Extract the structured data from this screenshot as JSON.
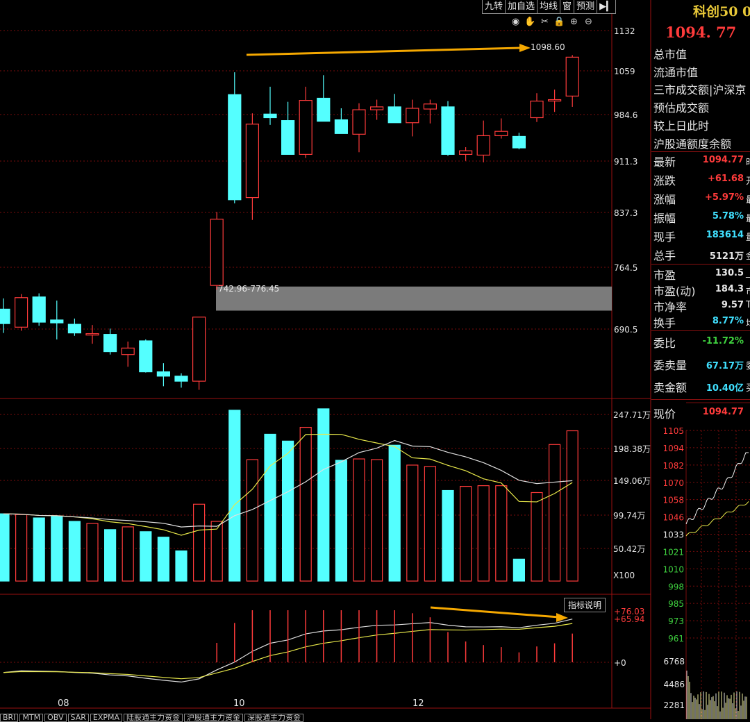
{
  "toolbar": {
    "buttons": [
      "九转",
      "加自选",
      "均线",
      "窗",
      "预测",
      "▶▎"
    ]
  },
  "tool_icons": [
    "eye-icon",
    "hand-icon",
    "scissors-icon",
    "lock-icon",
    "zoom-in-icon",
    "zoom-out-icon"
  ],
  "quote": {
    "name": "科创50 0",
    "last": "1094. 77",
    "info_labels": [
      "总市值",
      "流通市值",
      "三市成交额|沪深京",
      "预估成交额",
      "较上日此时",
      "沪股通额度余额"
    ],
    "stats": [
      {
        "label": "最新",
        "value": "1094.77",
        "suffix": "时",
        "color": "#ff3b3b"
      },
      {
        "label": "涨跌",
        "value": "+61.68",
        "suffix": "开",
        "color": "#ff3b3b"
      },
      {
        "label": "涨幅",
        "value": "+5.97%",
        "suffix": "最",
        "color": "#ff3b3b"
      },
      {
        "label": "振幅",
        "value": "5.78%",
        "suffix": "最",
        "color": "#40e0ff"
      },
      {
        "label": "现手",
        "value": "183614",
        "suffix": "量",
        "color": "#40e0ff"
      },
      {
        "label": "总手",
        "value": "5121万",
        "suffix": "金",
        "color": "#e6e6e6"
      }
    ],
    "valuation": [
      {
        "label": "市盈",
        "value": "130.5",
        "suffix": "_"
      },
      {
        "label": "市盈(动)",
        "value": "184.3",
        "suffix": "市"
      },
      {
        "label": "市净率",
        "value": "9.57",
        "suffix": "T"
      },
      {
        "label": "换手",
        "value": "8.77%",
        "suffix": "均",
        "color": "#40e0ff"
      }
    ],
    "order": [
      {
        "label": "委比",
        "value": "-11.72%",
        "suffix": "",
        "color": "#3fd23f"
      },
      {
        "label": "委卖量",
        "value": "67.17万",
        "suffix": "委",
        "color": "#40e0ff"
      },
      {
        "label": "卖金额",
        "value": "10.40亿",
        "suffix": "买",
        "color": "#40e0ff"
      }
    ],
    "intraday_label": "现价",
    "intraday_value": "1094.77",
    "intraday_ticks": [
      "1105",
      "1094",
      "1082",
      "1070",
      "1058",
      "1046",
      "1033",
      "1021",
      "1010",
      "998",
      "985",
      "973",
      "961"
    ],
    "intraday_vol_ticks": [
      "6768",
      "4486",
      "2281"
    ]
  },
  "x_labels": [
    "08",
    "10",
    "12"
  ],
  "indicator_tabs": [
    "BRI",
    "MTM",
    "OBV",
    "SAR",
    "EXPMA",
    "陆股通主力资金",
    "沪股通主力资金",
    "深股通主力资金"
  ],
  "indicator_button": "指标说明",
  "chart_data": {
    "type": "candlestick",
    "price_axis": {
      "ticks": [
        "1132",
        "1059",
        "984.6",
        "911.3",
        "837.3",
        "764.5",
        "690.5"
      ],
      "min": 620,
      "max": 1132
    },
    "annotations": {
      "peak_label": "1098.60",
      "gap_label": "742.96-776.45",
      "gap_range": [
        742.96,
        776.45
      ]
    },
    "candles": [
      {
        "o": 745,
        "h": 760,
        "l": 712,
        "c": 725
      },
      {
        "o": 720,
        "h": 766,
        "l": 715,
        "c": 761
      },
      {
        "o": 762,
        "h": 767,
        "l": 722,
        "c": 727
      },
      {
        "o": 730,
        "h": 757,
        "l": 703,
        "c": 726
      },
      {
        "o": 724,
        "h": 732,
        "l": 708,
        "c": 712
      },
      {
        "o": 711,
        "h": 723,
        "l": 697,
        "c": 711
      },
      {
        "o": 710,
        "h": 718,
        "l": 682,
        "c": 686
      },
      {
        "o": 682,
        "h": 700,
        "l": 665,
        "c": 691
      },
      {
        "o": 701,
        "h": 703,
        "l": 657,
        "c": 658
      },
      {
        "o": 658,
        "h": 670,
        "l": 638,
        "c": 652
      },
      {
        "o": 652,
        "h": 656,
        "l": 636,
        "c": 645
      },
      {
        "o": 645,
        "h": 734,
        "l": 633,
        "c": 734
      },
      {
        "o": 778,
        "h": 880,
        "l": 772,
        "c": 870
      },
      {
        "o": 1043,
        "h": 1074,
        "l": 892,
        "c": 897
      },
      {
        "o": 900,
        "h": 1017,
        "l": 869,
        "c": 1002
      },
      {
        "o": 1016,
        "h": 1054,
        "l": 1001,
        "c": 1011
      },
      {
        "o": 1007,
        "h": 1033,
        "l": 960,
        "c": 960
      },
      {
        "o": 960,
        "h": 1054,
        "l": 955,
        "c": 1035
      },
      {
        "o": 1038,
        "h": 1070,
        "l": 1008,
        "c": 1006
      },
      {
        "o": 1008,
        "h": 1024,
        "l": 994,
        "c": 989
      },
      {
        "o": 988,
        "h": 1031,
        "l": 963,
        "c": 1022
      },
      {
        "o": 1022,
        "h": 1036,
        "l": 1008,
        "c": 1026
      },
      {
        "o": 1026,
        "h": 1044,
        "l": 1004,
        "c": 1004
      },
      {
        "o": 1004,
        "h": 1036,
        "l": 985,
        "c": 1024
      },
      {
        "o": 1023,
        "h": 1036,
        "l": 1003,
        "c": 1030
      },
      {
        "o": 1026,
        "h": 1034,
        "l": 958,
        "c": 960
      },
      {
        "o": 960,
        "h": 970,
        "l": 951,
        "c": 965
      },
      {
        "o": 959,
        "h": 1007,
        "l": 949,
        "c": 986
      },
      {
        "o": 986,
        "h": 1010,
        "l": 982,
        "c": 992
      },
      {
        "o": 985,
        "h": 990,
        "l": 967,
        "c": 969
      },
      {
        "o": 1011,
        "h": 1045,
        "l": 1005,
        "c": 1034
      },
      {
        "o": 1036,
        "h": 1050,
        "l": 1019,
        "c": 1036
      },
      {
        "o": 1041,
        "h": 1098,
        "l": 1026,
        "c": 1095
      }
    ],
    "volume_axis": {
      "ticks": [
        "247.71万",
        "198.38万",
        "149.06万",
        "99.74万",
        "50.42万"
      ],
      "unit": "X100",
      "max": 260
    },
    "volume": [
      98,
      97,
      92,
      94,
      87,
      84,
      75,
      79,
      72,
      64,
      44,
      112,
      87,
      249,
      177,
      214,
      204,
      224,
      251,
      176,
      178,
      177,
      198,
      169,
      167,
      132,
      138,
      139,
      139,
      32,
      129,
      199,
      219
    ],
    "indicator_axis": {
      "ticks": [
        "+76.03",
        "+65.94",
        "+0"
      ]
    }
  }
}
